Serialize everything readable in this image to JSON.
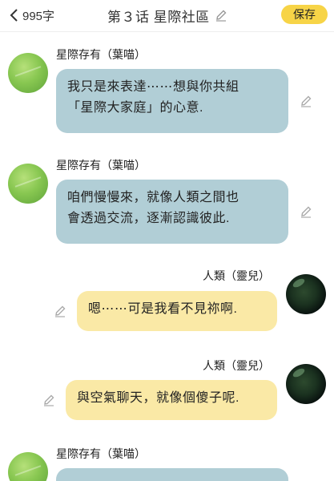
{
  "header": {
    "word_count": "995字",
    "title": "第３话 星際社區",
    "save_label": "保存"
  },
  "messages": [
    {
      "sender": "星際存有（葉喵）",
      "text": "我只是來表達⋯⋯想與你共組\n「星際大家庭」的心意.",
      "side": "left"
    },
    {
      "sender": "星際存有（葉喵）",
      "text": "咱們慢慢來，就像人類之間也\n會透過交流，逐漸認識彼此.",
      "side": "left"
    },
    {
      "sender": "人類（靈兒）",
      "text": "嗯⋯⋯可是我看不見祢啊.",
      "side": "right"
    },
    {
      "sender": "人類（靈兒）",
      "text": "與空氣聊天，就像個傻子呢.",
      "side": "right"
    },
    {
      "sender": "星際存有（葉喵）",
      "text": "",
      "side": "left"
    }
  ],
  "colors": {
    "accent": "#f7d447",
    "bubble_left": "#b1ced6",
    "bubble_right": "#fae9a6"
  },
  "icons": {
    "back": "chevron-left-icon",
    "edit": "pencil-icon"
  }
}
